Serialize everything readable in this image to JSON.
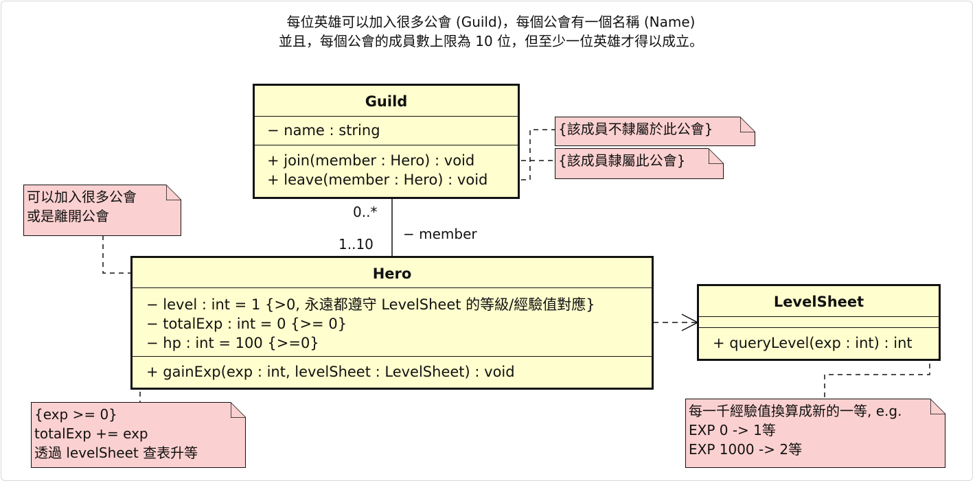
{
  "caption": {
    "line1": "每位英雄可以加入很多公會 (Guild)，每個公會有一個名稱 (Name)",
    "line2": "並且，每個公會的成員數上限為 10 位，但至少一位英雄才得以成立。"
  },
  "classes": {
    "guild": {
      "name": "Guild",
      "attributes": [
        "− name : string"
      ],
      "operations": [
        "+ join(member : Hero) : void",
        "+ leave(member : Hero) : void"
      ]
    },
    "hero": {
      "name": "Hero",
      "attributes": [
        "− level : int = 1 {>0, 永遠都遵守 LevelSheet 的等級/經驗值對應}",
        "− totalExp : int = 0 {>= 0}",
        "− hp : int = 100 {>=0}"
      ],
      "operations": [
        "+ gainExp(exp : int, levelSheet : LevelSheet) : void"
      ]
    },
    "levelsheet": {
      "name": "LevelSheet",
      "attributes": [],
      "operations": [
        "+ queryLevel(exp : int) : int"
      ]
    }
  },
  "association": {
    "guild_multiplicity": "0..*",
    "hero_multiplicity": "1..10",
    "role": "− member"
  },
  "notes": {
    "not_member": [
      "{該成員不隸屬於此公會}"
    ],
    "is_member": [
      "{該成員隸屬此公會}"
    ],
    "join_many": [
      "可以加入很多公會",
      "或是離開公會"
    ],
    "gain_exp": [
      "{exp >= 0}",
      "totalExp += exp",
      "透過 levelSheet 查表升等"
    ],
    "query_level": [
      "每一千經驗值換算成新的一等, e.g.",
      "EXP 0 -> 1等",
      "EXP 1000 -> 2等"
    ]
  },
  "colors": {
    "class_fill": "#fefece",
    "note_fill": "#fbd0d0",
    "border": "#111111"
  }
}
